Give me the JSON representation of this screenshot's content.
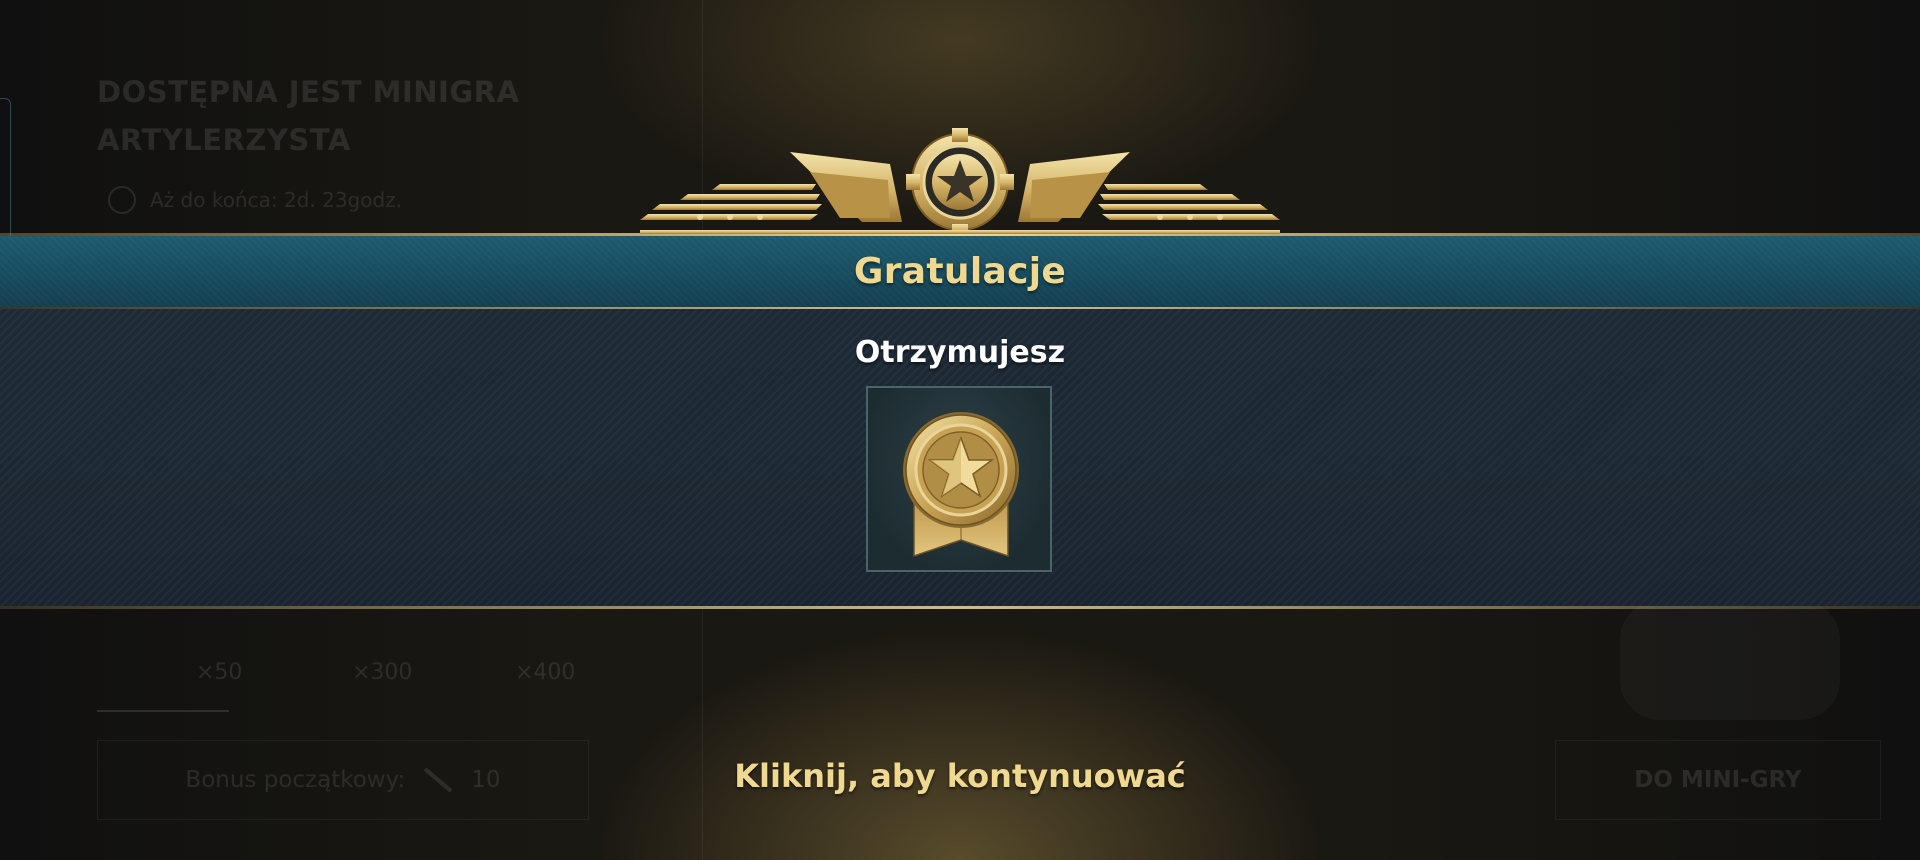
{
  "background": {
    "event_title": "DOSTĘPNA JEST MINIGRA\nARTYLERZYSTA",
    "timer_text": "Aż do końca: 2d. 23godz.",
    "rewards": [
      "×50",
      "×300",
      "×400"
    ],
    "bonus_label": "Bonus początkowy:",
    "bonus_value": "10",
    "minigame_button": "DO MINI-GRY"
  },
  "dialog": {
    "title": "Gratulacje",
    "subtitle": "Otrzymujesz",
    "reward_icon": "gold-star-medal-icon",
    "continue_prompt": "Kliknij, aby kontynuować"
  },
  "colors": {
    "title_gold": "#efd88f",
    "title_bar_teal": "#1e5a6f",
    "panel_navy": "#1c2833",
    "emblem_gold": "#d9bd72"
  }
}
